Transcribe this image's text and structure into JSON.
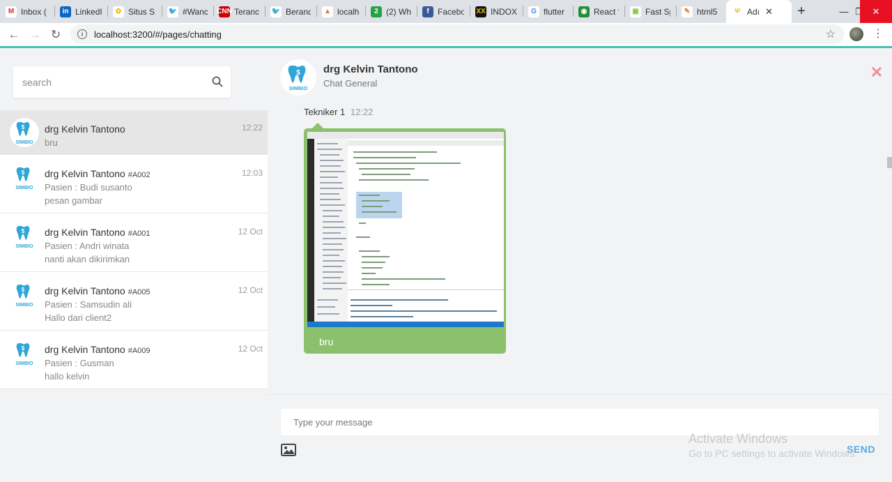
{
  "browser": {
    "tabs": [
      {
        "label": "Inbox (",
        "fav": "M",
        "fav_color": "#ffffff",
        "fav_text": "#d93025"
      },
      {
        "label": "LinkedI",
        "fav": "in",
        "fav_color": "#0a66c2",
        "fav_text": "#ffffff"
      },
      {
        "label": "Situs S",
        "fav": "✿",
        "fav_color": "#ffffff",
        "fav_text": "#f4b400"
      },
      {
        "label": "#Wanc",
        "fav": "🐦",
        "fav_color": "#ffffff",
        "fav_text": "#1da1f2"
      },
      {
        "label": "Teranc",
        "fav": "CNN",
        "fav_color": "#cc0000",
        "fav_text": "#ffffff"
      },
      {
        "label": "Berand",
        "fav": "🐦",
        "fav_color": "#ffffff",
        "fav_text": "#1da1f2"
      },
      {
        "label": "localhc",
        "fav": "▲",
        "fav_color": "#ffffff",
        "fav_text": "#e0772a"
      },
      {
        "label": "(2) Wh",
        "fav": "2",
        "fav_color": "#25a244",
        "fav_text": "#ffffff"
      },
      {
        "label": "Facebo",
        "fav": "f",
        "fav_color": "#3b5998",
        "fav_text": "#ffffff"
      },
      {
        "label": "INDOX",
        "fav": "XX",
        "fav_color": "#111111",
        "fav_text": "#f4c20d"
      },
      {
        "label": "flutter",
        "fav": "G",
        "fav_color": "#ffffff",
        "fav_text": "#4285f4"
      },
      {
        "label": "React ?",
        "fav": "◉",
        "fav_color": "#1f8f3a",
        "fav_text": "#ffffff"
      },
      {
        "label": "Fast Sp",
        "fav": "▣",
        "fav_color": "#ffffff",
        "fav_text": "#8bc34a"
      },
      {
        "label": "html5",
        "fav": "✎",
        "fav_color": "#ffffff",
        "fav_text": "#e77b22"
      },
      {
        "label": "Adı",
        "fav": "Ψ",
        "fav_color": "#ffffff",
        "fav_text": "#f4c20d",
        "active": true
      }
    ],
    "new_tab": "+",
    "url": "localhost:3200/#/pages/chatting",
    "nav": {
      "back": "←",
      "forward": "→",
      "reload": "↻"
    }
  },
  "sidebar": {
    "search_placeholder": "search",
    "conversations": [
      {
        "name": "drg Kelvin Tantono",
        "code": "",
        "time": "12:22",
        "line2": "bru",
        "line3": "",
        "selected": true
      },
      {
        "name": "drg Kelvin Tantono",
        "code": "#A002",
        "time": "12:03",
        "line2": "Pasien : Budi susanto",
        "line3": "pesan gambar"
      },
      {
        "name": "drg Kelvin Tantono",
        "code": "#A001",
        "time": "12 Oct",
        "line2": "Pasien : Andri winata",
        "line3": "nanti akan dikirimkan"
      },
      {
        "name": "drg Kelvin Tantono",
        "code": "#A005",
        "time": "12 Oct",
        "line2": "Pasien : Samsudin ali",
        "line3": "Hallo dari client2"
      },
      {
        "name": "drg Kelvin Tantono",
        "code": "#A009",
        "time": "12 Oct",
        "line2": "Pasien : Gusman",
        "line3": "hallo kelvin"
      }
    ]
  },
  "chat": {
    "title": "drg Kelvin Tantono",
    "subtitle": "Chat General",
    "logo_text": "SIMBIO",
    "message": {
      "sender": "Tekniker 1",
      "time": "12:22",
      "text": "bru"
    },
    "input_placeholder": "Type your message",
    "send_label": "SEND"
  },
  "watermark": {
    "line1": "Activate Windows",
    "line2": "Go to PC settings to activate Windows."
  },
  "colors": {
    "accent": "#41c4b3",
    "bubble": "#8bc16c",
    "send": "#5aa8e0",
    "close": "#f08a9c"
  }
}
